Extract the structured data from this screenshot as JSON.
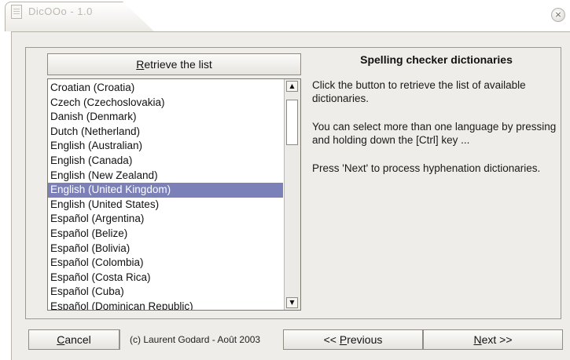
{
  "window": {
    "title": "DicOOo - 1.0",
    "close_symbol": "×"
  },
  "retrieve_button": {
    "label_mnemonic": "R",
    "label_rest": "etrieve the list"
  },
  "languages": {
    "items": [
      "Croatian (Croatia)",
      "Czech (Czechoslovakia)",
      "Danish (Denmark)",
      "Dutch (Netherland)",
      "English (Australian)",
      "English (Canada)",
      "English (New Zealand)",
      "English (United Kingdom)",
      "English (United States)",
      "Español (Argentina)",
      "Español (Belize)",
      "Español (Bolivia)",
      "Español (Colombia)",
      "Español (Costa Rica)",
      "Español (Cuba)",
      "Español (Dominican Republic)"
    ],
    "selected": "English (United Kingdom)",
    "scroll_up_symbol": "▲",
    "scroll_down_symbol": "▼"
  },
  "info": {
    "title": "Spelling checker dictionaries",
    "line1": "Click the button to retrieve the list of available dictionaries.",
    "line2": "You can select more than one language by pressing and holding down  the [Ctrl] key ...",
    "line3": "Press 'Next' to process hyphenation dictionaries."
  },
  "footer": {
    "cancel_mnemonic": "C",
    "cancel_rest": "ancel",
    "credit": "(c) Laurent Godard - Août 2003",
    "previous_prefix": "<< ",
    "previous_mnemonic": "P",
    "previous_rest": "revious",
    "next_mnemonic": "N",
    "next_rest": "ext >>"
  },
  "colors": {
    "selection": "#7b80b8",
    "dialog_background": "#eeede9"
  },
  "icons": {
    "title_icon": "document-icon",
    "close_icon": "close-icon"
  }
}
